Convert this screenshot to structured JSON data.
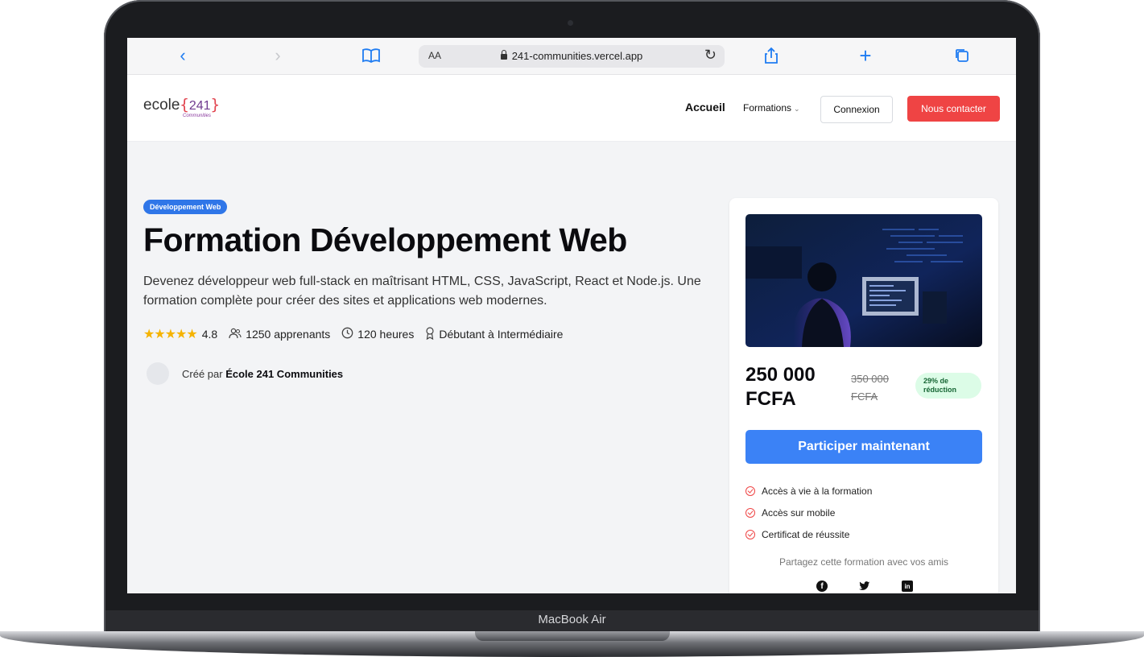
{
  "device": {
    "label": "MacBook Air"
  },
  "browser": {
    "text_size_label": "AA",
    "url": "241-communities.vercel.app",
    "icons": [
      "back-icon",
      "forward-icon",
      "bookmarks-icon",
      "lock-icon",
      "reload-icon",
      "share-icon",
      "new-tab-icon",
      "tabs-icon"
    ]
  },
  "header": {
    "logo": {
      "word": "ecole",
      "number": "241",
      "subline": "Communities"
    },
    "nav": {
      "home": "Accueil",
      "formations": "Formations"
    },
    "login_button": "Connexion",
    "contact_button": "Nous contacter"
  },
  "hero": {
    "category_badge": "Développement Web",
    "title": "Formation Développement Web",
    "description": "Devenez développeur web full-stack en maîtrisant HTML, CSS, JavaScript, React et Node.js. Une formation complète pour créer des sites et applications web modernes.",
    "rating": "4.8",
    "stars": "★★★★★",
    "students": "1250 apprenants",
    "duration": "120 heures",
    "level": "Débutant à Intermédiaire",
    "author_prefix": "Créé par",
    "author_name": "École 241 Communities"
  },
  "card": {
    "price": "250 000 FCFA",
    "old_price": "350 000 FCFA",
    "discount": "29% de réduction",
    "cta": "Participer maintenant",
    "features": [
      "Accès à vie à la formation",
      "Accès sur mobile",
      "Certificat de réussite"
    ],
    "share_text": "Partagez cette formation avec vos amis",
    "social": [
      "facebook",
      "twitter",
      "linkedin"
    ]
  },
  "colors": {
    "accent_blue": "#3b82f6",
    "contact_red": "#ef4444",
    "discount_bg": "#dcfce7",
    "discount_text": "#166534",
    "stars": "#f5b301"
  }
}
